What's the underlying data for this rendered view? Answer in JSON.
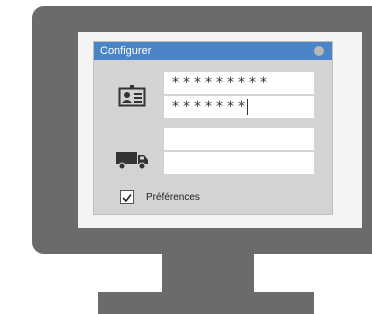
{
  "dialog": {
    "title": "Configurer",
    "title_color": "#4a86c7",
    "credentials_icon": "id-card-icon",
    "username_value": "*********",
    "password_value": "*******",
    "delivery_icon": "truck-icon",
    "delivery_field_1": "",
    "delivery_field_2": "",
    "preferences_label": "Préférences",
    "preferences_checked": true
  },
  "monitor": {
    "frame_color": "#6b6b6b"
  }
}
